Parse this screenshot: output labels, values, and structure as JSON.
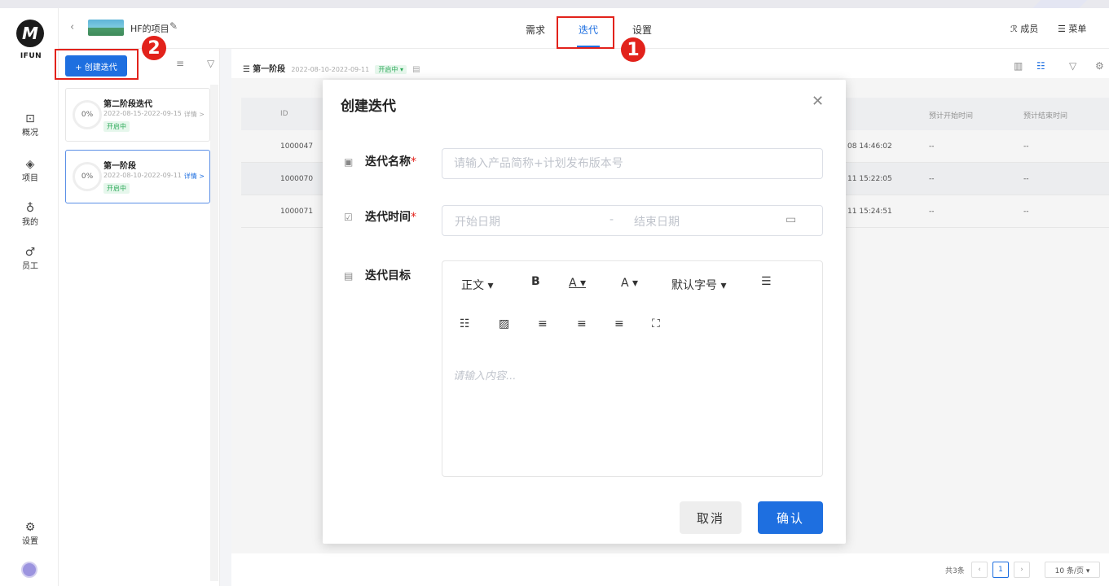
{
  "app": {
    "logo_glyph": "M",
    "logo_text": "IFUN"
  },
  "header": {
    "project_name": "HF的项目",
    "tabs": [
      {
        "label": "需求"
      },
      {
        "label": "迭代"
      },
      {
        "label": "设置"
      }
    ],
    "members_label": "成员",
    "menu_label": "菜单"
  },
  "annotations": {
    "badge1": "1",
    "badge2": "2"
  },
  "rail": {
    "items": [
      {
        "label": "概况"
      },
      {
        "label": "项目"
      },
      {
        "label": "我的"
      },
      {
        "label": "员工"
      }
    ],
    "settings_label": "设置"
  },
  "iterations": {
    "create_label": "+ 创建迭代",
    "cards": [
      {
        "name": "第二阶段迭代",
        "progress": "0%",
        "dates": "2022-08-15-2022-09-15",
        "detail": "详情 >",
        "status": "开启中"
      },
      {
        "name": "第一阶段",
        "progress": "0%",
        "dates": "2022-08-10-2022-09-11",
        "detail": "详情 >",
        "status": "开启中"
      }
    ]
  },
  "main": {
    "current_iteration": "第一阶段",
    "current_dates": "2022-08-10-2022-09-11",
    "current_status": "开启中 ▾",
    "columns": {
      "id": "ID",
      "start": "预计开始时间",
      "end": "预计结束时间"
    },
    "rows": [
      {
        "id": "1000047",
        "created": "08 14:46:02",
        "start": "--",
        "end": "--"
      },
      {
        "id": "1000070",
        "created": "11 15:22:05",
        "start": "--",
        "end": "--"
      },
      {
        "id": "1000071",
        "created": "11 15:24:51",
        "start": "--",
        "end": "--"
      }
    ],
    "pagination": {
      "total": "共3条",
      "current_page": "1",
      "page_size": "10 条/页 ▾"
    }
  },
  "modal": {
    "title": "创建迭代",
    "name_label": "迭代名称",
    "name_placeholder": "请输入产品简称+计划发布版本号",
    "time_label": "迭代时间",
    "start_placeholder": "开始日期",
    "end_placeholder": "结束日期",
    "range_sep": "-",
    "goal_label": "迭代目标",
    "required_mark": "*",
    "toolbar": {
      "paragraph": "正文 ▾",
      "bold": "B",
      "font_color": "A ▾",
      "bg_color": "A ▾",
      "font_size": "默认字号 ▾"
    },
    "editor_placeholder": "请输入内容...",
    "cancel_label": "取消",
    "confirm_label": "确认"
  },
  "colors": {
    "accent": "#1e6fe0",
    "annotation_red": "#e2221b",
    "status_green": "#2eaa5a"
  }
}
